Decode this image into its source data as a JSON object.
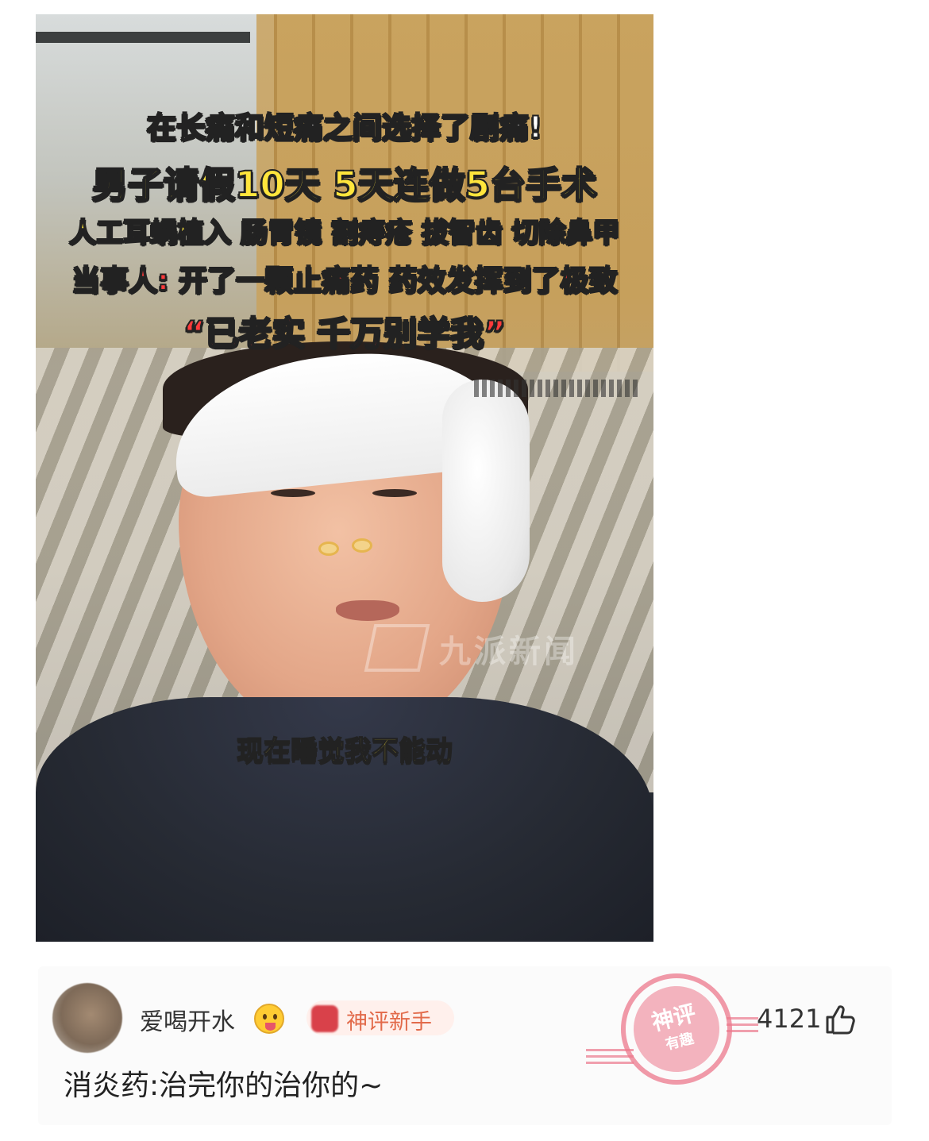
{
  "post_image": {
    "headline_1": "在长痛和短痛之间选择了剧痛!",
    "headline_2": "男子请假10天 5天连做5台手术",
    "headline_3": "人工耳蜗植入 肠胃镜 割痔疮 拔智齿 切除鼻甲",
    "headline_4": "当事人: 开了一颗止痛药 药效发挥到了极致",
    "headline_5": "“已老实 千万别学我”",
    "subtitle": "现在睡觉我不能动",
    "watermark": "九派新闻"
  },
  "comment": {
    "username": "爱喝开水",
    "emoji": "tongue-out-emoji",
    "badge_label": "神评新手",
    "stamp_line1": "神评",
    "stamp_line2": "有趣",
    "like_count": "4121",
    "text": "消炎药:治完你的治你的~"
  },
  "colors": {
    "headline_white": "#ffffff",
    "headline_yellow": "#ffe53c",
    "headline_red": "#ff3b3b",
    "badge_text": "#e26a4a",
    "stamp_pink": "#ec788c"
  }
}
